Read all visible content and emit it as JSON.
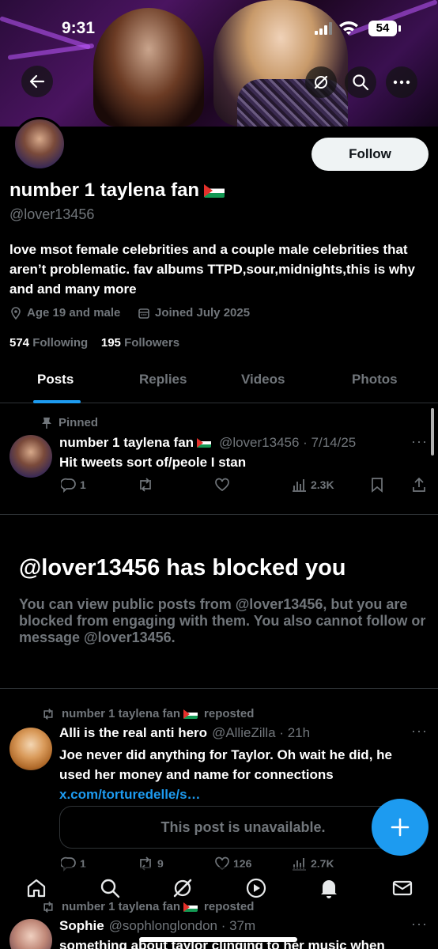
{
  "status_bar": {
    "time": "9:31",
    "battery": "54"
  },
  "profile": {
    "display_name": "number 1 taylena fan",
    "handle": "@lover13456",
    "bio": "love msot female celebrities and a couple male celebrities that aren’t problematic. fav albums TTPD,sour,midnights,this is why and and many more",
    "location": "Age 19 and male",
    "joined": "Joined July 2025",
    "following_count": "574",
    "following_label": "Following",
    "followers_count": "195",
    "followers_label": "Followers",
    "follow_button": "Follow"
  },
  "tabs": [
    {
      "label": "Posts",
      "active": true
    },
    {
      "label": "Replies",
      "active": false
    },
    {
      "label": "Videos",
      "active": false
    },
    {
      "label": "Photos",
      "active": false
    }
  ],
  "pinned_post": {
    "pinned_label": "Pinned",
    "author": "number 1 taylena fan",
    "meta": "@lover13456 · 7/14/25",
    "text": "Hit tweets sort of/peole I stan",
    "replies": "1",
    "retweets": "",
    "likes": "",
    "views": "2.3K"
  },
  "blocked": {
    "title": "@lover13456 has blocked you",
    "text": "You can view public posts from @lover13456, but you are blocked from engaging with them. You also cannot follow or message @lover13456."
  },
  "repost1": {
    "repost_label": "number 1 taylena fan",
    "repost_suffix": "reposted",
    "author": "Alli is the real anti hero",
    "meta": "@AllieZilla · 21h",
    "text": "Joe never did anything for Taylor. Oh wait he did, he used her money and name for connections ",
    "link": "x.com/torturedelle/s…",
    "unavailable": "This post is unavailable.",
    "replies": "1",
    "retweets": "9",
    "likes": "126",
    "views": "2.7K"
  },
  "repost2": {
    "repost_label": "number 1 taylena fan",
    "repost_suffix": "reposted",
    "author": "Sophie",
    "meta": "@sophlonglondon · 37m",
    "text": "something about taylor clinging to her music when"
  },
  "colors": {
    "accent": "#1d9bf0",
    "background": "#000000",
    "muted": "#71767b"
  }
}
